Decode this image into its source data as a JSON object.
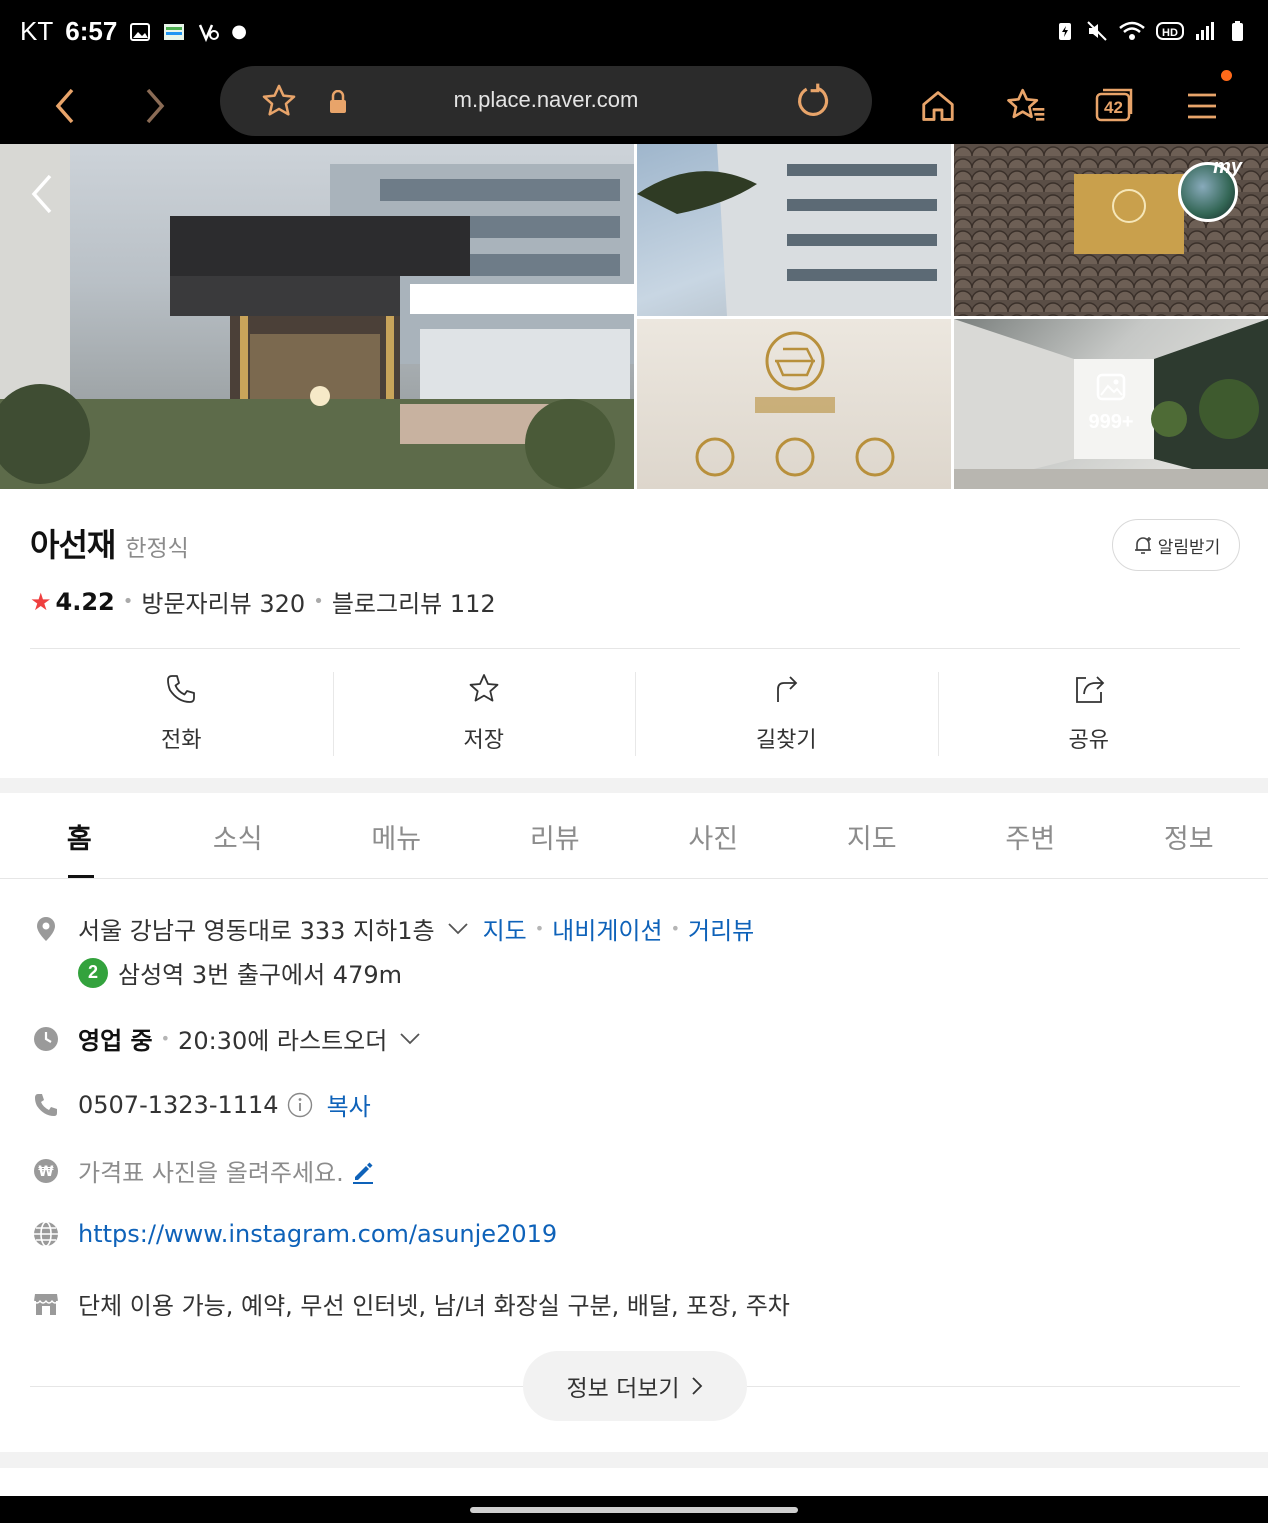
{
  "status_bar": {
    "carrier": "KT",
    "time": "6:57"
  },
  "browser": {
    "url": "m.place.naver.com",
    "tab_count": "42",
    "colors": {
      "background": "#000000",
      "url_box": "#2b2b2b",
      "notification_dot": "#ff6a1a"
    }
  },
  "gallery": {
    "more_photos_label": "999+",
    "my_badge": "my"
  },
  "place": {
    "name": "아선재",
    "category": "한정식",
    "alarm_label": "알림받기",
    "rating": "4.22",
    "visitor_reviews": "방문자리뷰 320",
    "blog_reviews": "블로그리뷰 112"
  },
  "actions": [
    {
      "label": "전화",
      "icon": "phone-icon"
    },
    {
      "label": "저장",
      "icon": "star-icon"
    },
    {
      "label": "길찾기",
      "icon": "directions-icon"
    },
    {
      "label": "공유",
      "icon": "share-icon"
    }
  ],
  "tabs": [
    "홈",
    "소식",
    "메뉴",
    "리뷰",
    "사진",
    "지도",
    "주변",
    "정보"
  ],
  "info": {
    "address": "서울 강남구 영동대로 333 지하1층",
    "address_links": [
      "지도",
      "내비게이션",
      "거리뷰"
    ],
    "subway_line": "2",
    "subway_text": "삼성역 3번 출구에서 479m",
    "hours_status": "영업 중",
    "hours_detail": "20:30에 라스트오더",
    "phone": "0507-1323-1114",
    "copy_label": "복사",
    "price_prompt": "가격표 사진을 올려주세요.",
    "website": "https://www.instagram.com/asunje2019",
    "amenities": "단체 이용 가능, 예약, 무선 인터넷, 남/녀 화장실 구분, 배달, 포장, 주차"
  },
  "more_button": "정보 더보기",
  "colors": {
    "link": "#0e62b9",
    "rating_star": "#ef3f3f",
    "subway_line_2": "#33a23d"
  }
}
